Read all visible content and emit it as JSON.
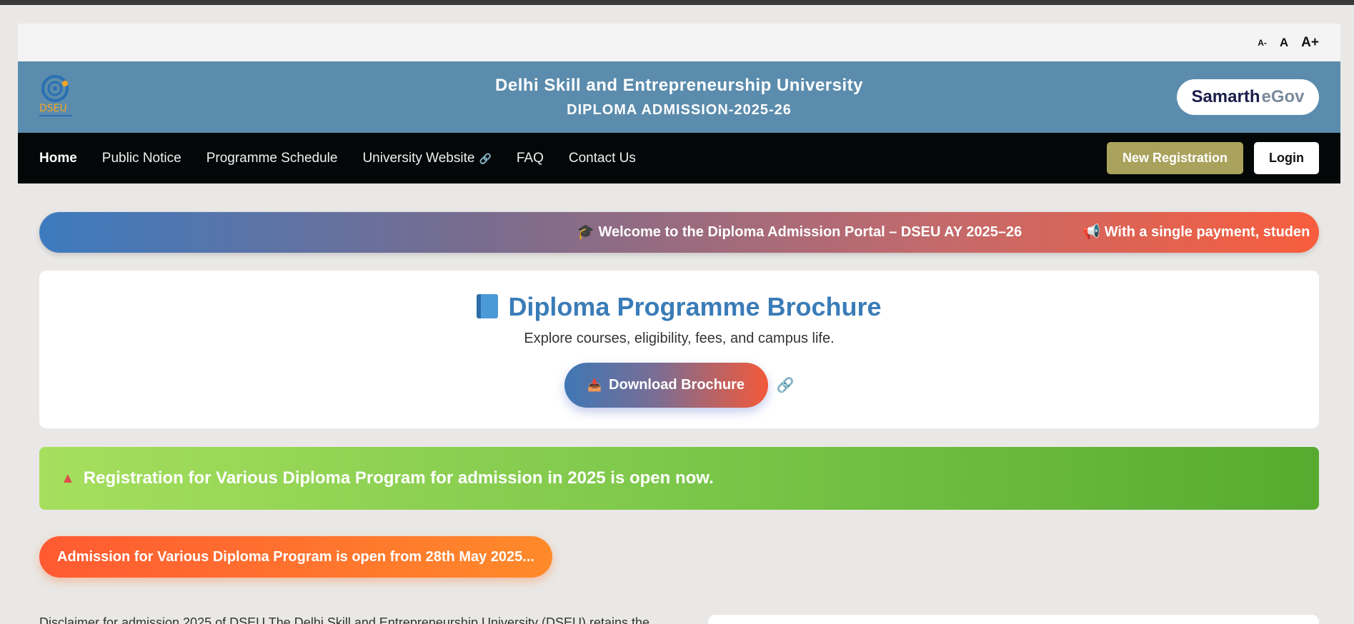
{
  "accessibility": {
    "decrease": "A-",
    "normal": "A",
    "increase": "A+"
  },
  "header": {
    "logo_text": "DSEU",
    "title": "Delhi Skill and Entrepreneurship University",
    "subtitle": "DIPLOMA ADMISSION-2025-26",
    "samarth_part1": "Samarth",
    "samarth_part2": "eGov"
  },
  "nav": {
    "items": [
      {
        "label": "Home"
      },
      {
        "label": "Public Notice"
      },
      {
        "label": "Programme Schedule"
      },
      {
        "label": "University Website"
      },
      {
        "label": "FAQ"
      },
      {
        "label": "Contact Us"
      }
    ],
    "new_registration": "New Registration",
    "login": "Login"
  },
  "ticker": {
    "message1": "🎓 Welcome to the Diploma Admission Portal – DSEU AY 2025–26",
    "message2": "📢 With a single payment, studen"
  },
  "brochure": {
    "title": "Diploma Programme Brochure",
    "subtitle": "Explore courses, eligibility, fees, and campus life.",
    "button": "Download Brochure"
  },
  "announcement": "Registration for Various Diploma Program for admission in 2025 is open now.",
  "admission_notice": "Admission for Various Diploma Program is open from 28th May 2025...",
  "disclaimer": "Disclaimer for admission 2025 of DSEU The Delhi Skill and Entrepreneurship University (DSEU) retains the",
  "colors": {
    "header_bg": "#5b8cad",
    "nav_bg": "#030708",
    "new_registration_bg": "#a9a25c",
    "brochure_title": "#3a7cb8",
    "logo_blue": "#2a6fb3",
    "logo_orange": "#f5a623"
  }
}
